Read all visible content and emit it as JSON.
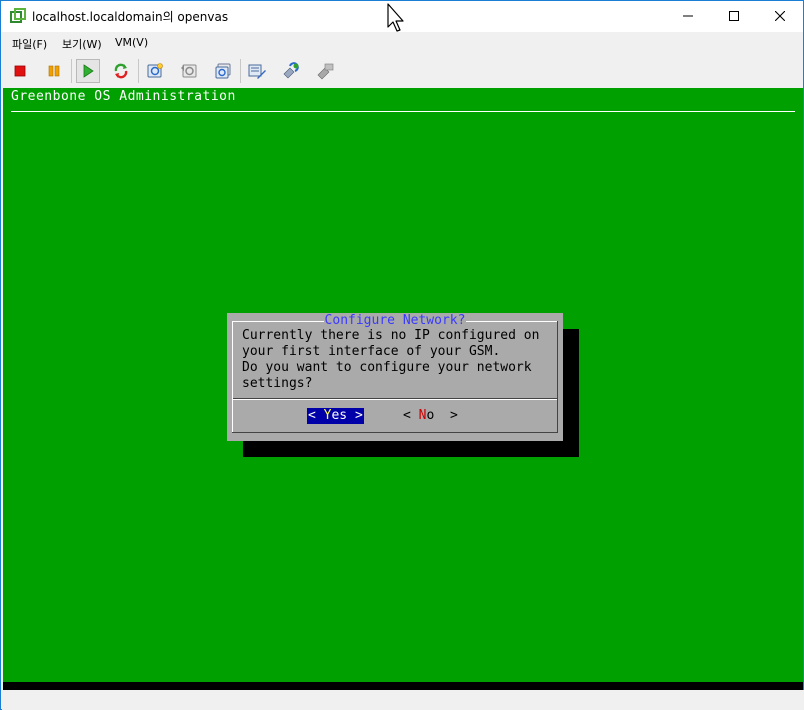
{
  "window": {
    "title": "localhost.localdomain의 openvas",
    "accent": "#1a7fd4"
  },
  "menu": [
    {
      "label": "파일(F)"
    },
    {
      "label": "보기(W)"
    },
    {
      "label": "VM(V)"
    }
  ],
  "toolbar": [
    {
      "icon": "stop-icon"
    },
    {
      "icon": "pause-icon"
    },
    {
      "icon": "play-icon",
      "active": true
    },
    {
      "icon": "reset-icon"
    },
    {
      "icon": "snapshot-take-icon"
    },
    {
      "icon": "snapshot-revert-icon"
    },
    {
      "icon": "snapshot-manager-icon"
    },
    {
      "icon": "vm-settings-icon"
    },
    {
      "icon": "vm-tools-icon"
    },
    {
      "icon": "vm-disabled-tool-icon"
    }
  ],
  "console": {
    "background": "#00a000",
    "header": "Greenbone OS Administration",
    "dialog": {
      "title": "Configure Network?",
      "lines": [
        "Currently there is no IP configured on",
        "your first interface of your GSM.",
        "Do you want to configure your network",
        "settings?"
      ],
      "yes_button": {
        "pre": "< ",
        "hot": "Y",
        "rest": "es",
        "post": " >",
        "selected": true
      },
      "no_button": {
        "pre": "< ",
        "hot": "N",
        "rest": "o",
        "post": "  >"
      }
    }
  }
}
